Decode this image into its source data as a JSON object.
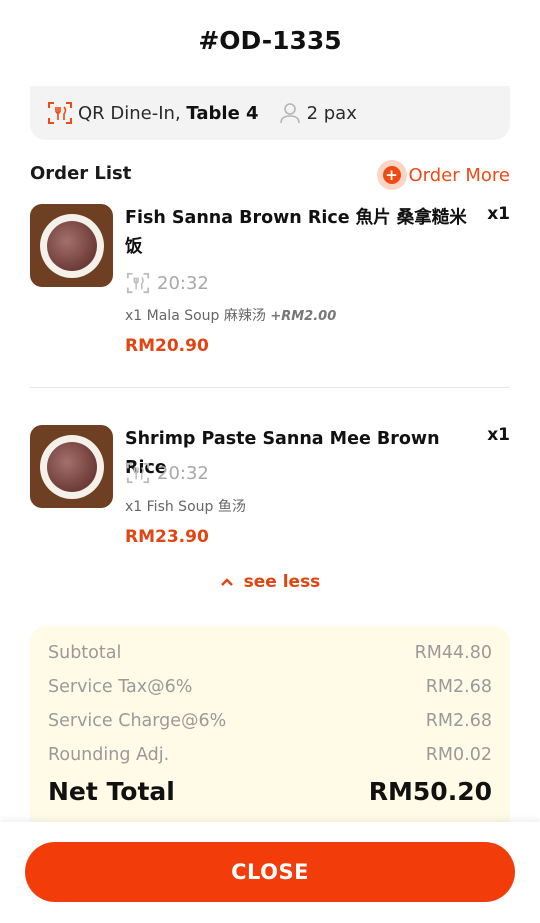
{
  "header": {
    "order_id": "#OD-1335"
  },
  "info": {
    "dine_prefix": "QR Dine-In, ",
    "table": "Table 4",
    "pax": "2 pax"
  },
  "order_list": {
    "label": "Order List",
    "order_more_label": "Order More"
  },
  "items": [
    {
      "name": "Fish Sanna Brown Rice 魚片 桑拿糙米饭",
      "qty": "x1",
      "time": "20:32",
      "addon": "x1 Mala Soup 麻辣汤",
      "addon_price": "+RM2.00",
      "price": "RM20.90"
    },
    {
      "name": "Shrimp Paste Sanna Mee Brown Rice",
      "qty": "x1",
      "time": "20:32",
      "addon": "x1 Fish Soup 鱼汤",
      "addon_price": "",
      "price": "RM23.90"
    }
  ],
  "see_less_label": "see less",
  "summary": {
    "subtotal_label": "Subtotal",
    "subtotal": "RM44.80",
    "tax_label": "Service Tax@6%",
    "tax": "RM2.68",
    "charge_label": "Service Charge@6%",
    "charge": "RM2.68",
    "rounding_label": "Rounding Adj.",
    "rounding": "RM0.02",
    "net_total_label": "Net Total",
    "net_total": "RM50.20"
  },
  "footer": {
    "close_label": "CLOSE"
  },
  "colors": {
    "accent": "#f04a14",
    "summary_bg": "#fffbe6",
    "button": "#f23d0a"
  },
  "icons": [
    "dine-in-icon",
    "person-icon",
    "plus-icon",
    "dine-time-icon",
    "chevron-up-icon"
  ]
}
